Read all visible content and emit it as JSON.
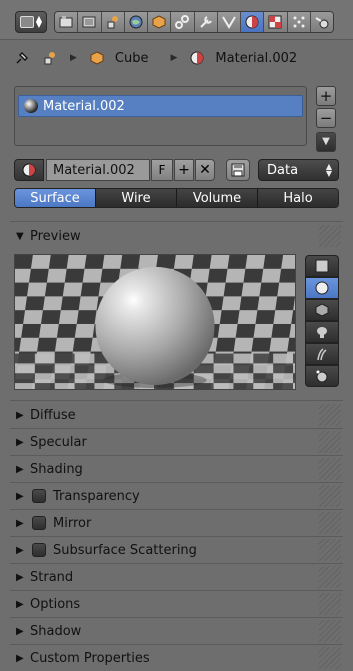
{
  "header": {
    "editor_type_icon": "properties-editor-icon",
    "context_tabs": [
      {
        "icon": "render-icon",
        "active": false
      },
      {
        "icon": "render-layers-icon",
        "active": false
      },
      {
        "icon": "scene-icon",
        "active": false
      },
      {
        "icon": "world-icon",
        "active": false
      },
      {
        "icon": "object-icon",
        "active": false
      },
      {
        "icon": "constraints-icon",
        "active": false
      },
      {
        "icon": "modifiers-icon",
        "active": false
      },
      {
        "icon": "data-icon",
        "active": false
      },
      {
        "icon": "material-icon",
        "active": true
      },
      {
        "icon": "texture-icon",
        "active": false
      },
      {
        "icon": "particles-icon",
        "active": false
      },
      {
        "icon": "physics-icon",
        "active": false
      }
    ]
  },
  "breadcrumb": {
    "object": "Cube",
    "material": "Material.002"
  },
  "material_slots": {
    "items": [
      "Material.002"
    ],
    "add_label": "+",
    "remove_label": "−",
    "menu_label": "▼"
  },
  "id_block": {
    "name": "Material.002",
    "fake_user_label": "F",
    "new_label": "+",
    "unlink_label": "✕",
    "link_value": "Data"
  },
  "type_tabs": [
    {
      "label": "Surface",
      "active": true
    },
    {
      "label": "Wire",
      "active": false
    },
    {
      "label": "Volume",
      "active": false
    },
    {
      "label": "Halo",
      "active": false
    }
  ],
  "preview": {
    "label": "Preview",
    "shape_buttons": [
      {
        "icon": "flat-plane-icon",
        "active": false
      },
      {
        "icon": "sphere-icon",
        "active": true
      },
      {
        "icon": "cube-icon",
        "active": false
      },
      {
        "icon": "monkey-icon",
        "active": false
      },
      {
        "icon": "hair-icon",
        "active": false
      },
      {
        "icon": "sky-sphere-icon",
        "active": false
      }
    ]
  },
  "panels": [
    {
      "label": "Diffuse",
      "checkbox": false
    },
    {
      "label": "Specular",
      "checkbox": false
    },
    {
      "label": "Shading",
      "checkbox": false
    },
    {
      "label": "Transparency",
      "checkbox": true
    },
    {
      "label": "Mirror",
      "checkbox": true
    },
    {
      "label": "Subsurface Scattering",
      "checkbox": true
    },
    {
      "label": "Strand",
      "checkbox": false
    },
    {
      "label": "Options",
      "checkbox": false
    },
    {
      "label": "Shadow",
      "checkbox": false
    },
    {
      "label": "Custom Properties",
      "checkbox": false
    }
  ],
  "colors": {
    "background": "#6e6e6e",
    "accent": "#5680c2",
    "dark_button": "#3a3a3a"
  }
}
